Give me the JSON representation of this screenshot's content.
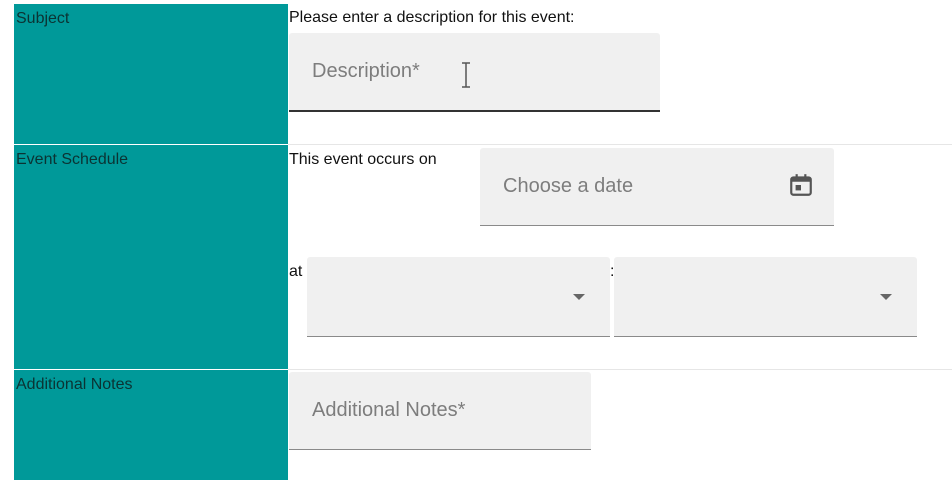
{
  "rows": {
    "subject": {
      "label": "Subject",
      "prompt": "Please enter a description for this event:",
      "description_placeholder": "Description*"
    },
    "schedule": {
      "label": "Event Schedule",
      "occurs_on_text": "This event occurs on",
      "date_placeholder": "Choose a date",
      "at_text": "at",
      "time_separator": ":",
      "hour_value": "",
      "minute_value": ""
    },
    "notes": {
      "label": "Additional Notes",
      "notes_placeholder": "Additional Notes*"
    }
  },
  "icons": {
    "calendar": "calendar-icon",
    "dropdown": "chevron-down-icon",
    "cursor": "text-cursor-icon"
  },
  "colors": {
    "label_background": "#009999",
    "field_background": "#f0f0f0"
  }
}
